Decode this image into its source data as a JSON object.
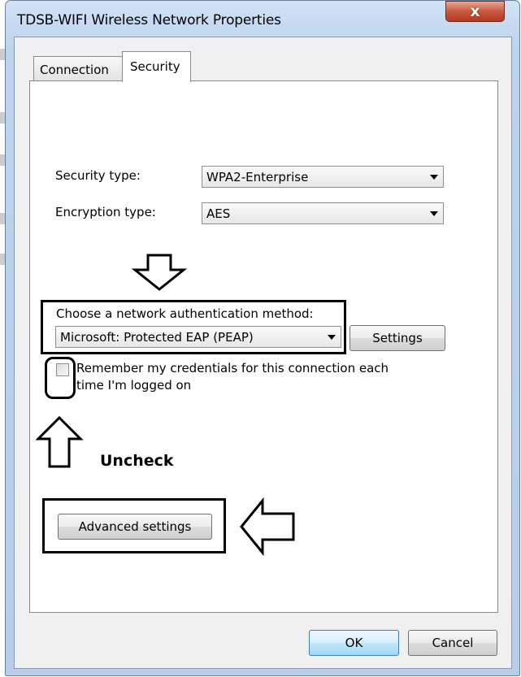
{
  "window": {
    "title": "TDSB-WIFI Wireless Network Properties",
    "close_glyph": "x"
  },
  "tabs": [
    {
      "label": "Connection",
      "selected": false
    },
    {
      "label": "Security",
      "selected": true
    }
  ],
  "security": {
    "security_type_label": "Security type:",
    "security_type_value": "WPA2-Enterprise",
    "encryption_type_label": "Encryption type:",
    "encryption_type_value": "AES",
    "auth_method_label": "Choose a network authentication method:",
    "auth_method_value": "Microsoft: Protected EAP (PEAP)",
    "settings_button": "Settings",
    "remember_line1": "Remember my credentials for this connection each",
    "remember_line2": "time I'm logged on",
    "remember_checked": false,
    "advanced_button": "Advanced settings"
  },
  "annotations": {
    "uncheck_text": "Uncheck"
  },
  "footer": {
    "ok_button": "OK",
    "cancel_button": "Cancel"
  },
  "colors": {
    "close_button": "#c75a40",
    "ok_button": "#bee6fd",
    "window_frame": "#bcd3ee"
  },
  "icons": [
    "close-icon",
    "dropdown-arrow-icon",
    "down-arrow-annotation-icon",
    "up-arrow-annotation-icon",
    "left-arrow-annotation-icon"
  ]
}
